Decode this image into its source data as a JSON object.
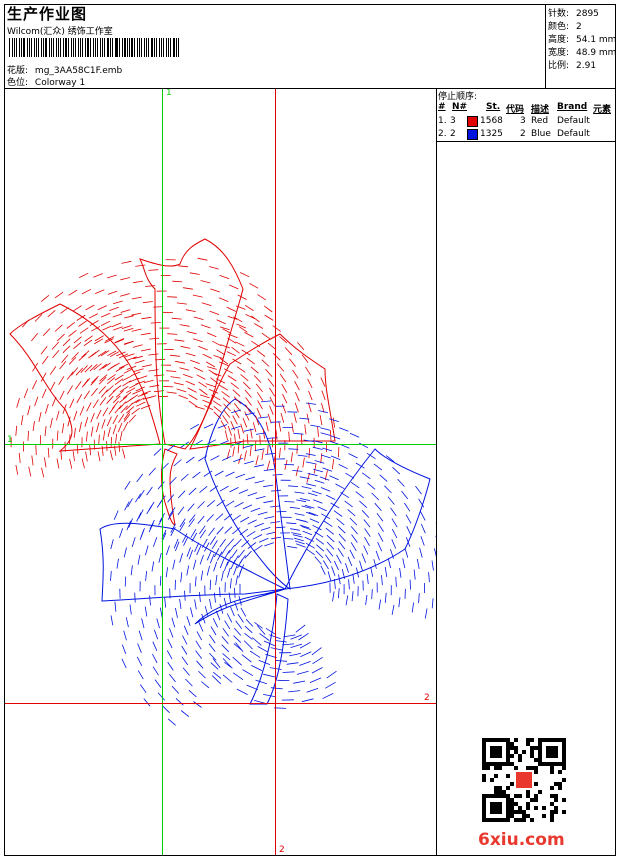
{
  "header": {
    "title": "生产作业图",
    "company": "Wilcom(汇众) 绣饰工作室",
    "design_label": "花版:",
    "design_file": "mg_3AA58C1F.emb",
    "colorway_label": "色位:",
    "colorway": "Colorway 1"
  },
  "stats": [
    {
      "label": "针数:",
      "value": "2895"
    },
    {
      "label": "颜色:",
      "value": "2"
    },
    {
      "label": "高度:",
      "value": "54.1 mm"
    },
    {
      "label": "宽度:",
      "value": "48.9 mm"
    },
    {
      "label": "比例:",
      "value": "2.91"
    }
  ],
  "stop_sequence": {
    "title": "停止顺序:",
    "headers": [
      "#",
      "N#",
      "St.",
      "代码",
      "描述",
      "Brand",
      "元素"
    ],
    "rows": [
      {
        "index": "1.",
        "needle": "3",
        "stitches": "1568",
        "code": "3",
        "description": "Red",
        "brand": "Default",
        "color": "#e00000"
      },
      {
        "index": "2.",
        "needle": "2",
        "stitches": "1325",
        "code": "2",
        "description": "Blue",
        "brand": "Default",
        "color": "#0014e0"
      }
    ]
  },
  "guides": {
    "label_1": "1",
    "label_2": "2",
    "green": "#00d000",
    "red": "#e00000"
  },
  "watermark": "6xiu.com"
}
